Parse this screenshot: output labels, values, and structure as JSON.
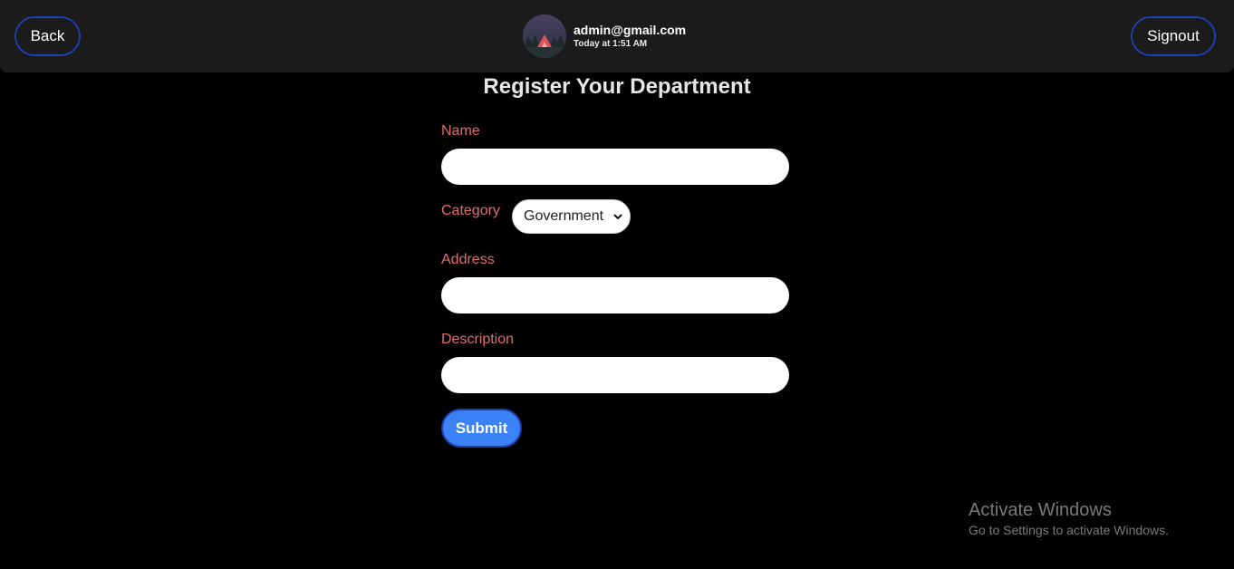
{
  "header": {
    "back_label": "Back",
    "signout_label": "Signout",
    "user_email": "admin@gmail.com",
    "user_time": "Today at 1:51 AM"
  },
  "form": {
    "title": "Register Your Department",
    "name_label": "Name",
    "name_value": "",
    "category_label": "Category",
    "category_selected": "Government",
    "address_label": "Address",
    "address_value": "",
    "description_label": "Description",
    "description_value": "",
    "submit_label": "Submit"
  },
  "watermark": {
    "title": "Activate Windows",
    "subtitle": "Go to Settings to activate Windows."
  },
  "colors": {
    "accent": "#3b82f6",
    "label": "#e06c6c",
    "border": "#1e3fae"
  }
}
